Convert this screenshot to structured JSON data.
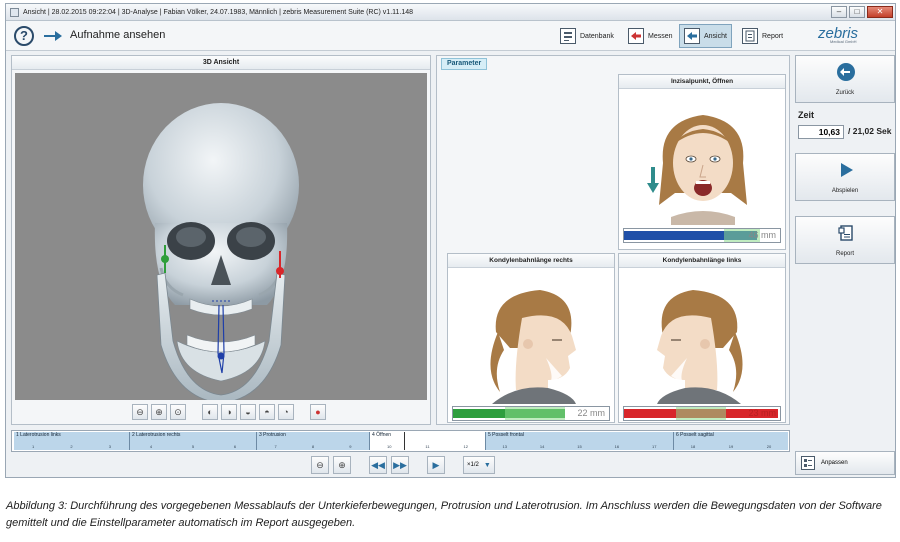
{
  "window": {
    "title": "Ansicht | 28.02.2015 09:22:04 | 3D-Analyse | Fabian Völker, 24.07.1983, Männlich | zebris Measurement Suite (RC) v1.11.148",
    "min": "–",
    "max": "□",
    "close": "✕"
  },
  "toolbar": {
    "title": "Aufnahme ansehen",
    "help": "?",
    "nav": [
      "Datenbank",
      "Messen",
      "Ansicht",
      "Report"
    ],
    "logo": "zebris",
    "logo_sub": "Medical GmbH"
  },
  "view3d": {
    "title": "3D Ansicht"
  },
  "params": {
    "tab": "Parameter",
    "cards": [
      {
        "title": "Inzisalpunkt, Öffnen",
        "value": "46 mm",
        "bar_fraction": 0.85,
        "bar_color": "#1f4fa8"
      },
      {
        "title": "Kondylenbahnlänge rechts",
        "value": "22 mm",
        "bar_fraction": 0.72,
        "bar_color": "#2e9e3e"
      },
      {
        "title": "Kondylenbahnlänge links",
        "value": "23 mm",
        "bar_fraction": 0.99,
        "bar_color": "#d8262a"
      }
    ]
  },
  "right": {
    "back": "Zurück",
    "time_label": "Zeit",
    "time_current": "10,63",
    "time_total": "/ 21,02 Sek",
    "play": "Abspielen",
    "report": "Report",
    "adjust": "Anpassen"
  },
  "timeline": {
    "segments": [
      {
        "label": "1 Laterotrusion links",
        "ticks": [
          "1",
          "2",
          "3"
        ]
      },
      {
        "label": "2 Laterotrusion rechts",
        "ticks": [
          "4",
          "5",
          "6"
        ]
      },
      {
        "label": "3 Protrusion",
        "ticks": [
          "7",
          "8",
          "9"
        ]
      },
      {
        "label": "4 Öffnen",
        "ticks": [
          "10",
          "11",
          "12"
        ]
      },
      {
        "label": "5 Posselt frontal",
        "ticks": [
          "13",
          "14",
          "15",
          "16",
          "17"
        ]
      },
      {
        "label": "6 Posselt sagittal",
        "ticks": [
          "18",
          "19",
          "20"
        ]
      }
    ],
    "speed": "×1/2"
  },
  "caption": "Abbildung 3: Durchführung des vorgegebenen Messablaufs der Unterkieferbewegungen, Protrusion und Laterotrusion. Im Anschluss werden die Bewegungsdaten von der Software gemittelt und die Einstellparameter automatisch im Report ausgegeben."
}
